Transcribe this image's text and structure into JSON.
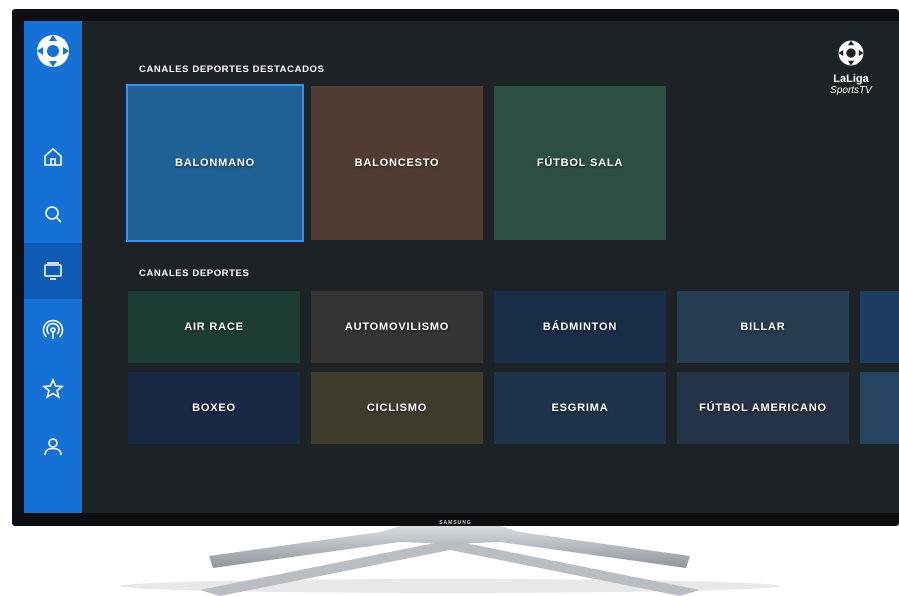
{
  "device": {
    "brand_label": "SAMSUNG"
  },
  "brand": {
    "name": "LaLiga",
    "subtitle": "SportsTV",
    "logo_icon": "laliga-logo-icon"
  },
  "sidebar": {
    "logo_icon": "laliga-logo-icon",
    "items": [
      {
        "name": "home",
        "icon": "home-icon"
      },
      {
        "name": "search",
        "icon": "search-icon"
      },
      {
        "name": "channels",
        "icon": "tv-icon",
        "active": true
      },
      {
        "name": "live",
        "icon": "broadcast-icon"
      },
      {
        "name": "favorites",
        "icon": "star-icon"
      },
      {
        "name": "profile",
        "icon": "user-icon"
      }
    ]
  },
  "featured": {
    "title": "CANALES DEPORTES DESTACADOS",
    "tiles": [
      {
        "label": "BALONMANO",
        "color": "#2d6b7a",
        "focused": true
      },
      {
        "label": "BALONCESTO",
        "color": "#8a5a3c"
      },
      {
        "label": "FÚTBOL SALA",
        "color": "#4b7a52"
      }
    ]
  },
  "sports": {
    "title": "CANALES DEPORTES",
    "row1": [
      {
        "label": "AIR RACE",
        "color": "#2f5a3e"
      },
      {
        "label": "AUTOMOVILISMO",
        "color": "#5a4a3a"
      },
      {
        "label": "BÁDMINTON",
        "color": "#23405f"
      },
      {
        "label": "BILLAR",
        "color": "#3d5a6e"
      }
    ],
    "row2": [
      {
        "label": "BOXEO",
        "color": "#23355a"
      },
      {
        "label": "CICLISMO",
        "color": "#6a5a2e"
      },
      {
        "label": "ESGRIMA",
        "color": "#2e4a66"
      },
      {
        "label": "FÚTBOL AMERICANO",
        "color": "#3a4a5e"
      }
    ]
  }
}
